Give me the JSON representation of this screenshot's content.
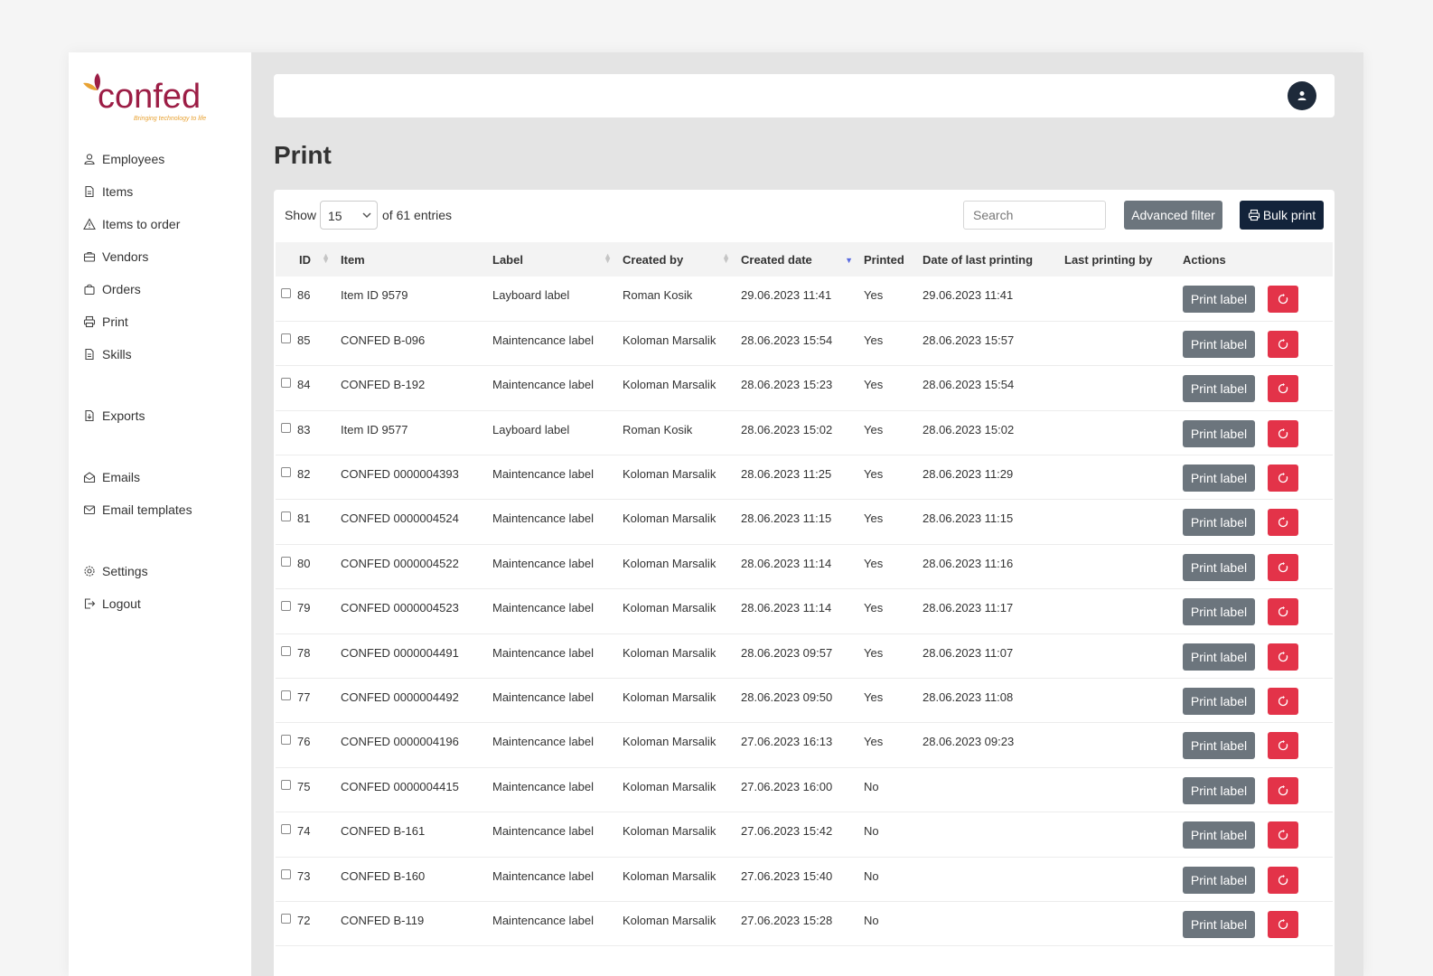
{
  "brand": {
    "logo_text": "confed",
    "tagline": "Bringing technology to life"
  },
  "sidebar": {
    "items": [
      {
        "label": "Employees",
        "icon": "user-icon"
      },
      {
        "label": "Items",
        "icon": "file-icon"
      },
      {
        "label": "Items to order",
        "icon": "warning-icon"
      },
      {
        "label": "Vendors",
        "icon": "briefcase-icon"
      },
      {
        "label": "Orders",
        "icon": "bag-icon"
      },
      {
        "label": "Print",
        "icon": "printer-icon"
      },
      {
        "label": "Skills",
        "icon": "file-icon"
      },
      {
        "label": "Exports",
        "icon": "file-export-icon"
      },
      {
        "label": "Emails",
        "icon": "mail-open-icon"
      },
      {
        "label": "Email templates",
        "icon": "mail-icon"
      },
      {
        "label": "Settings",
        "icon": "gear-icon"
      },
      {
        "label": "Logout",
        "icon": "logout-icon"
      }
    ]
  },
  "page": {
    "title": "Print"
  },
  "toolbar": {
    "show_label": "Show",
    "page_length": "15",
    "entries_text": "of 61 entries",
    "search_placeholder": "Search",
    "advanced_filter": "Advanced filter",
    "bulk_print": "Bulk print"
  },
  "table": {
    "columns": [
      "ID",
      "Item",
      "Label",
      "Created by",
      "Created date",
      "Printed",
      "Date of last printing",
      "Last printing by",
      "Actions"
    ],
    "print_label": "Print label",
    "rows": [
      {
        "id": "86",
        "item": "Item ID 9579",
        "label": "Layboard label",
        "created_by": "Roman Kosik",
        "created_date": "29.06.2023 11:41",
        "printed": "Yes",
        "last_print": "29.06.2023 11:41",
        "last_by": ""
      },
      {
        "id": "85",
        "item": "CONFED B-096",
        "label": "Maintencance label",
        "created_by": "Koloman Marsalik",
        "created_date": "28.06.2023 15:54",
        "printed": "Yes",
        "last_print": "28.06.2023 15:57",
        "last_by": ""
      },
      {
        "id": "84",
        "item": "CONFED B-192",
        "label": "Maintencance label",
        "created_by": "Koloman Marsalik",
        "created_date": "28.06.2023 15:23",
        "printed": "Yes",
        "last_print": "28.06.2023 15:54",
        "last_by": ""
      },
      {
        "id": "83",
        "item": "Item ID 9577",
        "label": "Layboard label",
        "created_by": "Roman Kosik",
        "created_date": "28.06.2023 15:02",
        "printed": "Yes",
        "last_print": "28.06.2023 15:02",
        "last_by": ""
      },
      {
        "id": "82",
        "item": "CONFED 0000004393",
        "label": "Maintencance label",
        "created_by": "Koloman Marsalik",
        "created_date": "28.06.2023 11:25",
        "printed": "Yes",
        "last_print": "28.06.2023 11:29",
        "last_by": ""
      },
      {
        "id": "81",
        "item": "CONFED 0000004524",
        "label": "Maintencance label",
        "created_by": "Koloman Marsalik",
        "created_date": "28.06.2023 11:15",
        "printed": "Yes",
        "last_print": "28.06.2023 11:15",
        "last_by": ""
      },
      {
        "id": "80",
        "item": "CONFED 0000004522",
        "label": "Maintencance label",
        "created_by": "Koloman Marsalik",
        "created_date": "28.06.2023 11:14",
        "printed": "Yes",
        "last_print": "28.06.2023 11:16",
        "last_by": ""
      },
      {
        "id": "79",
        "item": "CONFED 0000004523",
        "label": "Maintencance label",
        "created_by": "Koloman Marsalik",
        "created_date": "28.06.2023 11:14",
        "printed": "Yes",
        "last_print": "28.06.2023 11:17",
        "last_by": ""
      },
      {
        "id": "78",
        "item": "CONFED 0000004491",
        "label": "Maintencance label",
        "created_by": "Koloman Marsalik",
        "created_date": "28.06.2023 09:57",
        "printed": "Yes",
        "last_print": "28.06.2023 11:07",
        "last_by": ""
      },
      {
        "id": "77",
        "item": "CONFED 0000004492",
        "label": "Maintencance label",
        "created_by": "Koloman Marsalik",
        "created_date": "28.06.2023 09:50",
        "printed": "Yes",
        "last_print": "28.06.2023 11:08",
        "last_by": ""
      },
      {
        "id": "76",
        "item": "CONFED 0000004196",
        "label": "Maintencance label",
        "created_by": "Koloman Marsalik",
        "created_date": "27.06.2023 16:13",
        "printed": "Yes",
        "last_print": "28.06.2023 09:23",
        "last_by": ""
      },
      {
        "id": "75",
        "item": "CONFED 0000004415",
        "label": "Maintencance label",
        "created_by": "Koloman Marsalik",
        "created_date": "27.06.2023 16:00",
        "printed": "No",
        "last_print": "",
        "last_by": ""
      },
      {
        "id": "74",
        "item": "CONFED B-161",
        "label": "Maintencance label",
        "created_by": "Koloman Marsalik",
        "created_date": "27.06.2023 15:42",
        "printed": "No",
        "last_print": "",
        "last_by": ""
      },
      {
        "id": "73",
        "item": "CONFED B-160",
        "label": "Maintencance label",
        "created_by": "Koloman Marsalik",
        "created_date": "27.06.2023 15:40",
        "printed": "No",
        "last_print": "",
        "last_by": ""
      },
      {
        "id": "72",
        "item": "CONFED B-119",
        "label": "Maintencance label",
        "created_by": "Koloman Marsalik",
        "created_date": "27.06.2023 15:28",
        "printed": "No",
        "last_print": "",
        "last_by": ""
      }
    ]
  },
  "colors": {
    "brand": "#9c1d45",
    "accent": "#e8a233",
    "secondary_button": "#6c757d",
    "primary_button": "#13233a",
    "danger_button": "#e33349"
  }
}
